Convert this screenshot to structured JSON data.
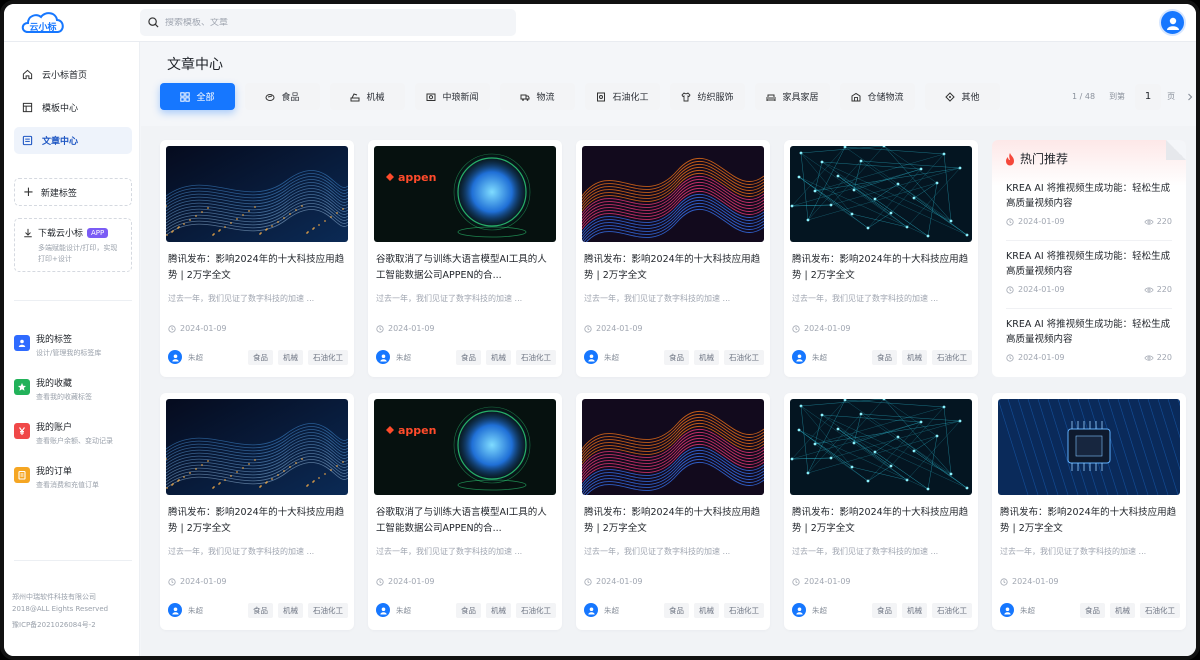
{
  "brand": {
    "logo_text": "云小标"
  },
  "search": {
    "placeholder": "搜索模板、文章"
  },
  "sidebar": {
    "nav": [
      {
        "label": "云小标首页",
        "icon": "home-icon"
      },
      {
        "label": "模板中心",
        "icon": "template-icon"
      },
      {
        "label": "文章中心",
        "icon": "article-icon",
        "active": true
      }
    ],
    "new_tag": "新建标签",
    "download": {
      "label": "下载云小标",
      "badge": "APP",
      "desc": "多端赋能设计/打印，实现打印+设计"
    },
    "links": [
      {
        "title": "我的标签",
        "desc": "设计/管理我的标签库",
        "icon": "user-card-icon",
        "color": "#2f6bff"
      },
      {
        "title": "我的收藏",
        "desc": "查看我的收藏标签",
        "icon": "star-icon",
        "color": "#22b25a"
      },
      {
        "title": "我的账户",
        "desc": "查看账户余额、变动记录",
        "icon": "yen-icon",
        "color": "#f04848"
      },
      {
        "title": "我的订单",
        "desc": "查看消费和充值订单",
        "icon": "order-icon",
        "color": "#f5a623"
      }
    ],
    "footer": {
      "company": "郑州中瑞软件科技有限公司",
      "rights": "2018@ALL Eights Reserved",
      "icp": "豫ICP备2021026084号-2"
    }
  },
  "page_title": "文章中心",
  "categories": [
    {
      "label": "全部",
      "icon": "grid-icon",
      "active": true
    },
    {
      "label": "食品",
      "icon": "food-icon"
    },
    {
      "label": "机械",
      "icon": "machine-icon"
    },
    {
      "label": "中琅新闻",
      "icon": "news-icon"
    },
    {
      "label": "物流",
      "icon": "truck-icon"
    },
    {
      "label": "石油化工",
      "icon": "oil-icon"
    },
    {
      "label": "纺织服饰",
      "icon": "shirt-icon"
    },
    {
      "label": "家具家居",
      "icon": "sofa-icon"
    },
    {
      "label": "仓储物流",
      "icon": "warehouse-icon"
    },
    {
      "label": "其他",
      "icon": "diamond-icon"
    }
  ],
  "pager": {
    "indicator": "1 / 48",
    "jump_label": "到第",
    "current": "1",
    "unit": "页"
  },
  "articles": [
    {
      "img": "wave-blue",
      "title": "腾讯发布：影响2024年的十大科技应用趋势 | 2万字全文",
      "summary": "过去一年，我们见证了数字科技的加速 ...",
      "date": "2024-01-09",
      "author": "朱超",
      "tags": [
        "食品",
        "机械",
        "石油化工"
      ]
    },
    {
      "img": "appen",
      "img_text": "appen",
      "title": "谷歌取消了与训练大语言模型AI工具的人工智能数据公司APPEN的合...",
      "summary": "过去一年，我们见证了数字科技的加速 ...",
      "date": "2024-01-09",
      "author": "朱超",
      "tags": [
        "食品",
        "机械",
        "石油化工"
      ]
    },
    {
      "img": "wave-orange",
      "title": "腾讯发布：影响2024年的十大科技应用趋势 | 2万字全文",
      "summary": "过去一年，我们见证了数字科技的加速 ...",
      "date": "2024-01-09",
      "author": "朱超",
      "tags": [
        "食品",
        "机械",
        "石油化工"
      ]
    },
    {
      "img": "network",
      "title": "腾讯发布：影响2024年的十大科技应用趋势 | 2万字全文",
      "summary": "过去一年，我们见证了数字科技的加速 ...",
      "date": "2024-01-09",
      "author": "朱超",
      "tags": [
        "食品",
        "机械",
        "石油化工"
      ]
    },
    {
      "img": "wave-blue",
      "title": "腾讯发布：影响2024年的十大科技应用趋势 | 2万字全文",
      "summary": "过去一年，我们见证了数字科技的加速 ...",
      "date": "2024-01-09",
      "author": "朱超",
      "tags": [
        "食品",
        "机械",
        "石油化工"
      ]
    },
    {
      "img": "appen",
      "img_text": "appen",
      "title": "谷歌取消了与训练大语言模型AI工具的人工智能数据公司APPEN的合...",
      "summary": "过去一年，我们见证了数字科技的加速 ...",
      "date": "2024-01-09",
      "author": "朱超",
      "tags": [
        "食品",
        "机械",
        "石油化工"
      ]
    },
    {
      "img": "wave-orange",
      "title": "腾讯发布：影响2024年的十大科技应用趋势 | 2万字全文",
      "summary": "过去一年，我们见证了数字科技的加速 ...",
      "date": "2024-01-09",
      "author": "朱超",
      "tags": [
        "食品",
        "机械",
        "石油化工"
      ]
    },
    {
      "img": "network",
      "title": "腾讯发布：影响2024年的十大科技应用趋势 | 2万字全文",
      "summary": "过去一年，我们见证了数字科技的加速 ...",
      "date": "2024-01-09",
      "author": "朱超",
      "tags": [
        "食品",
        "机械",
        "石油化工"
      ]
    },
    {
      "img": "chip",
      "title": "腾讯发布：影响2024年的十大科技应用趋势 | 2万字全文",
      "summary": "过去一年，我们见证了数字科技的加速 ...",
      "date": "2024-01-09",
      "author": "朱超",
      "tags": [
        "食品",
        "机械",
        "石油化工"
      ]
    }
  ],
  "hot": {
    "title": "热门推荐",
    "items": [
      {
        "title": "KREA AI 将推视频生成功能：轻松生成高质量视频内容",
        "date": "2024-01-09",
        "views": "220"
      },
      {
        "title": "KREA AI 将推视频生成功能：轻松生成高质量视频内容",
        "date": "2024-01-09",
        "views": "220"
      },
      {
        "title": "KREA AI 将推视频生成功能：轻松生成高质量视频内容",
        "date": "2024-01-09",
        "views": "220"
      }
    ]
  },
  "colors": {
    "primary": "#1677ff",
    "appen_red": "#ff4b2b",
    "hot_flame": "#f5483b"
  }
}
